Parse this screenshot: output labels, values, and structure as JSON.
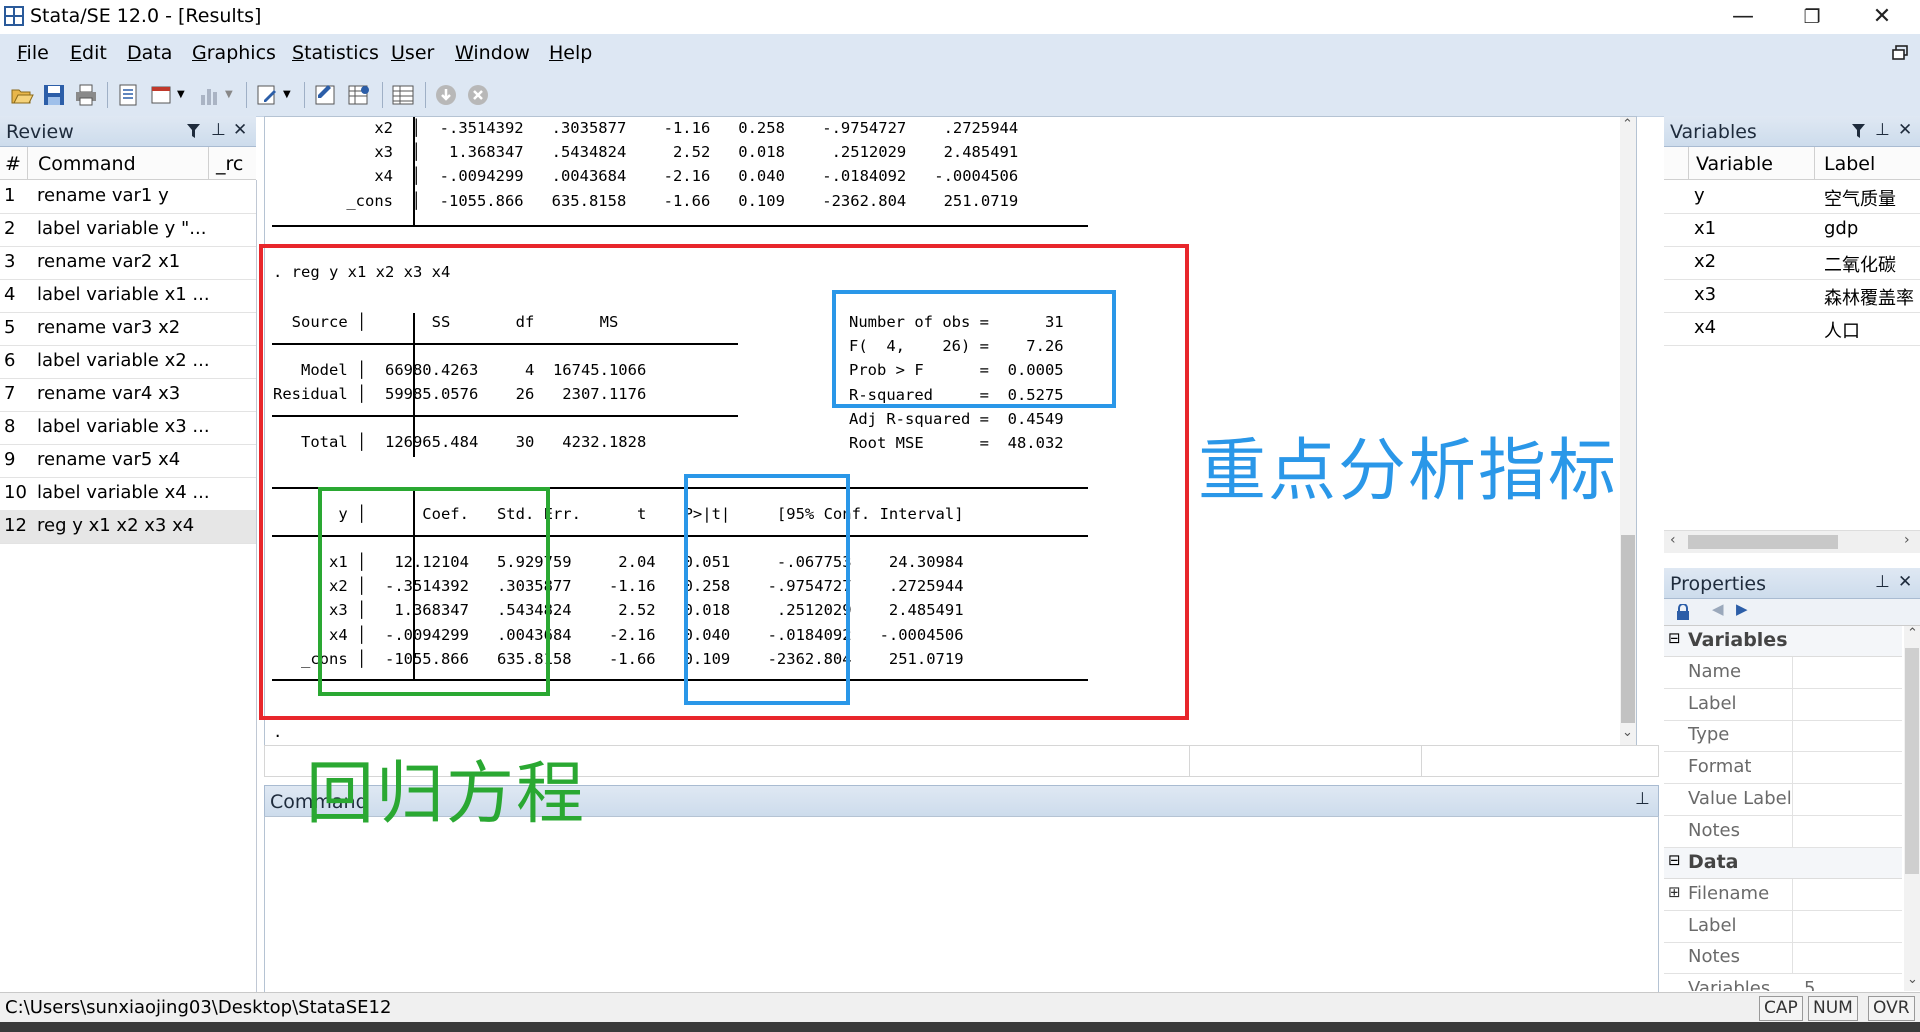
{
  "window": {
    "title": "Stata/SE 12.0 - [Results]",
    "minimize_glyph": "—",
    "restore_glyph": "❐",
    "close_glyph": "✕"
  },
  "menu": [
    {
      "label": "File",
      "ul": "F",
      "rest": "ile"
    },
    {
      "label": "Edit",
      "ul": "E",
      "rest": "dit"
    },
    {
      "label": "Data",
      "ul": "D",
      "rest": "ata"
    },
    {
      "label": "Graphics",
      "ul": "G",
      "rest": "raphics"
    },
    {
      "label": "Statistics",
      "ul": "S",
      "rest": "tatistics"
    },
    {
      "label": "User",
      "ul": "U",
      "rest": "ser"
    },
    {
      "label": "Window",
      "ul": "W",
      "rest": "indow"
    },
    {
      "label": "Help",
      "ul": "H",
      "rest": "elp"
    }
  ],
  "review": {
    "title": "Review",
    "col_num": "#",
    "col_command": "Command",
    "col_rc": "_rc",
    "items": [
      {
        "n": "1",
        "cmd": "rename var1 y"
      },
      {
        "n": "2",
        "cmd": "label variable y \"..."
      },
      {
        "n": "3",
        "cmd": "rename var2 x1"
      },
      {
        "n": "4",
        "cmd": "label variable x1 ..."
      },
      {
        "n": "5",
        "cmd": "rename var3 x2"
      },
      {
        "n": "6",
        "cmd": "label variable x2 ..."
      },
      {
        "n": "7",
        "cmd": "rename var4 x3"
      },
      {
        "n": "8",
        "cmd": "label variable x3 ..."
      },
      {
        "n": "9",
        "cmd": "rename var5 x4"
      },
      {
        "n": "10",
        "cmd": "label variable x4 ..."
      },
      {
        "n": "12",
        "cmd": "reg y x1 x2 x3 x4"
      }
    ]
  },
  "variables": {
    "title": "Variables",
    "col_variable": "Variable",
    "col_label": "Label",
    "items": [
      {
        "name": "y",
        "label": "空气质量"
      },
      {
        "name": "x1",
        "label": "gdp"
      },
      {
        "name": "x2",
        "label": "二氧化碳"
      },
      {
        "name": "x3",
        "label": "森林覆盖率"
      },
      {
        "name": "x4",
        "label": "人口"
      }
    ]
  },
  "properties": {
    "title": "Properties",
    "sec_variables": "Variables",
    "var_fields": [
      "Name",
      "Label",
      "Type",
      "Format",
      "Value Label",
      "Notes"
    ],
    "sec_data": "Data",
    "data_fields": [
      "Filename",
      "Label",
      "Notes"
    ],
    "partial_row": "Variables",
    "partial_value": "5"
  },
  "results": {
    "top_rows": [
      "    x2  │  -.3514392   .3035877    -1.16   0.258    -.9754727    .2725944",
      "    x3  │   1.368347   .5434824     2.52   0.018     .2512029    2.485491",
      "    x4  │  -.0094299   .0043684    -2.16   0.040    -.0184092   -.0004506",
      " _cons  │  -1055.866   635.8158    -1.66   0.109    -2362.804    251.0719"
    ],
    "command_line": ". reg y x1 x2 x3 x4",
    "anova_header": "  Source │       SS       df       MS",
    "anova_model": "   Model │  66980.4263     4  16745.1066",
    "anova_resid": "Residual │  59985.0576    26   2307.1176",
    "anova_total": "   Total │  126965.484    30   4232.1828",
    "stats": [
      "Number of obs =      31",
      "F(  4,    26) =    7.26",
      "Prob > F      =  0.0005",
      "R-squared     =  0.5275",
      "Adj R-squared =  0.4549",
      "Root MSE      =  48.032"
    ],
    "coef_header": "       y │      Coef.   Std. Err.      t    P>|t|     [95% Conf. Interval]",
    "coef_rows": [
      "      x1 │   12.12104   5.929759     2.04   0.051     -.067753    24.30984",
      "      x2 │  -.3514392   .3035877    -1.16   0.258    -.9754727    .2725944",
      "      x3 │   1.368347   .5434824     2.52   0.018     .2512029    2.485491",
      "      x4 │  -.0094299   .0043684    -2.16   0.040    -.0184092   -.0004506",
      "   _cons │  -1055.866   635.8158    -1.66   0.109    -2362.804    251.0719"
    ],
    "prompt": "."
  },
  "annotations": {
    "key_indicators": "重点分析指标",
    "regression_equation": "回归方程",
    "red": "#e8262b",
    "green": "#2aa832",
    "blue": "#2a97e8"
  },
  "command_window": {
    "title": "Command"
  },
  "status": {
    "path": "C:\\Users\\sunxiaojing03\\Desktop\\StataSE12",
    "cap": "CAP",
    "num": "NUM",
    "ovr": "OVR"
  }
}
